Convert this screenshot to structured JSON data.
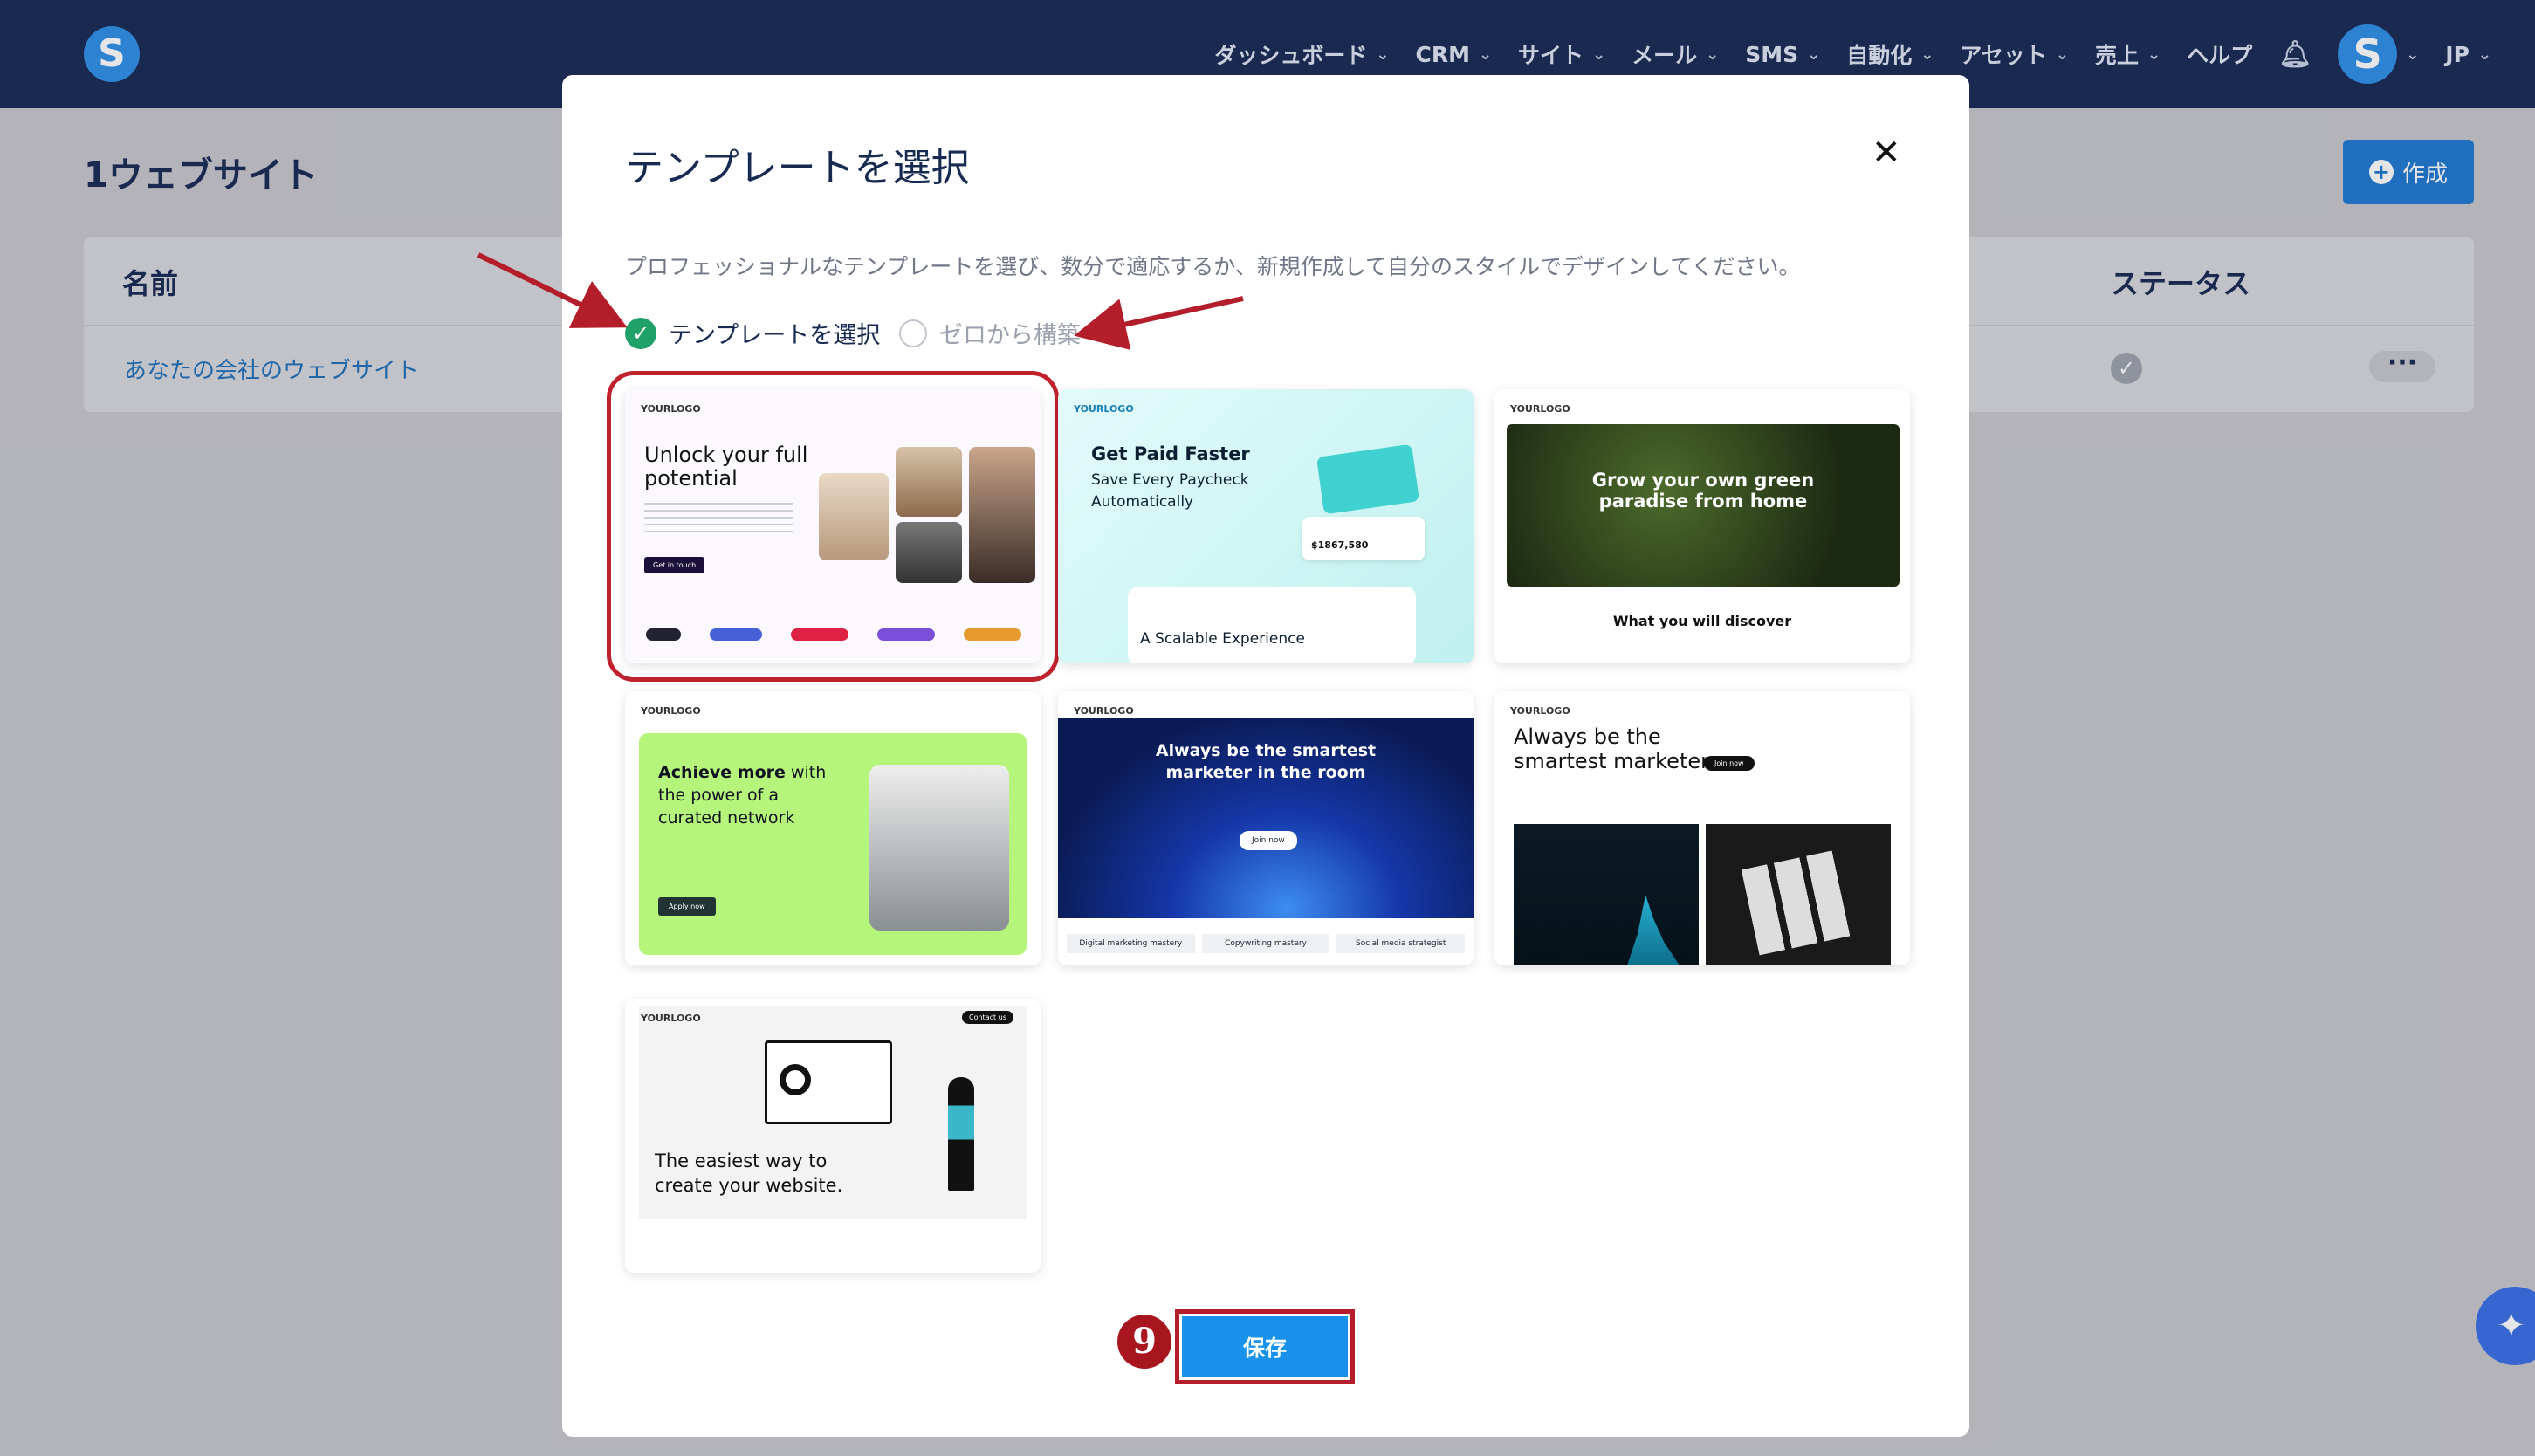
{
  "topbar": {
    "logo_letter": "S",
    "nav": [
      "ダッシュボード",
      "CRM",
      "サイト",
      "メール",
      "SMS",
      "自動化",
      "アセット",
      "売上",
      "ヘルプ"
    ],
    "avatar_letter": "S",
    "lang": "JP"
  },
  "page": {
    "title": "1ウェブサイト",
    "create_label": "作成",
    "columns": {
      "name": "名前",
      "status": "ステータス"
    },
    "row_name": "あなたの会社のウェブサイト"
  },
  "modal": {
    "title": "テンプレートを選択",
    "description": "プロフェッショナルなテンプレートを選び、数分で適応するか、新規作成して自分のスタイルでデザインしてください。",
    "option_template": "テンプレートを選択",
    "option_scratch": "ゼロから構築",
    "save_label": "保存",
    "step_number": "9"
  },
  "templates": [
    {
      "heading": "Unlock your full potential",
      "logo": "YOURLOGO",
      "cta": "Get in touch",
      "selected": true
    },
    {
      "heading": "Get Paid Faster",
      "subheading": "Save Every Paycheck Automatically",
      "logo": "YOURLOGO",
      "amount": "$1867,580",
      "footer": "A Scalable Experience"
    },
    {
      "heading": "Grow your own green paradise from home",
      "logo": "YOURLOGO",
      "footer": "What you will discover"
    },
    {
      "heading_bold": "Achieve more",
      "heading_rest": "with the power of a curated network",
      "logo": "YOURLOGO",
      "cta": "Apply now"
    },
    {
      "heading": "Always be the smartest marketer in the room",
      "logo": "YOURLOGO",
      "cta": "Join now",
      "tags": [
        "Digital marketing mastery",
        "Copywriting mastery",
        "Social media strategist"
      ]
    },
    {
      "heading": "Always be the smartest marketer",
      "logo": "YOURLOGO",
      "cta": "Join now"
    },
    {
      "heading": "The easiest way to create your website.",
      "logo": "YOURLOGO",
      "cta": "Contact us"
    }
  ],
  "colors": {
    "topbar": "#172a52",
    "accent": "#1892ea",
    "annotation": "#b41e2a",
    "check": "#20a16a"
  }
}
